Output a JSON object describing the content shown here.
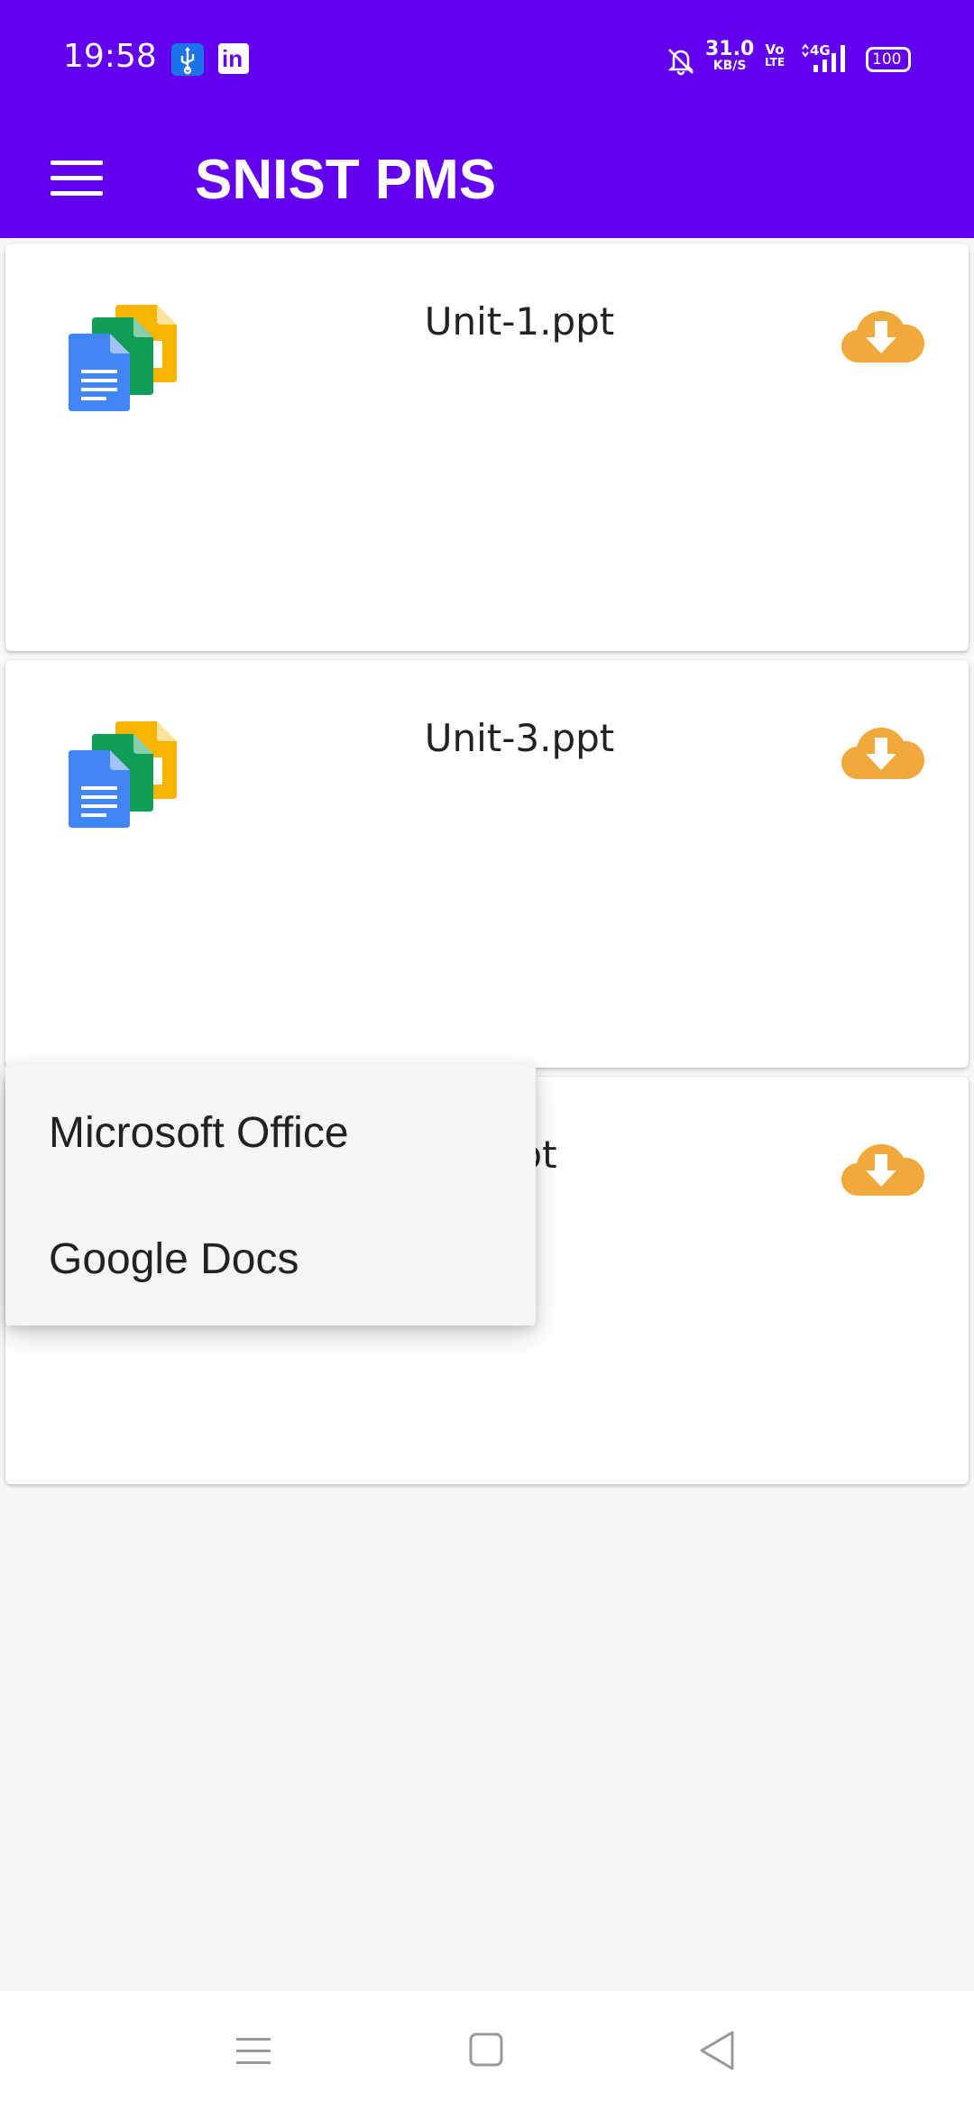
{
  "status_bar": {
    "time": "19:58",
    "icons": [
      "usb-debug-icon",
      "linkedin-icon",
      "bell-off-icon",
      "volte-icon",
      "signal-icon",
      "battery-icon"
    ],
    "net_speed_value": "31.0",
    "net_speed_unit": "KB/S",
    "volte_top": "Vo",
    "volte_bottom": "LTE",
    "network_type": "4G",
    "battery_level": "100"
  },
  "app_bar": {
    "title": "SNIST PMS",
    "menu_icon": "hamburger-icon",
    "color": "#6200ee"
  },
  "files": [
    {
      "name": "Unit-1.ppt",
      "icon": "documents-icon",
      "action_icon": "cloud-download-icon"
    },
    {
      "name": "Unit-3.ppt",
      "icon": "documents-icon",
      "action_icon": "cloud-download-icon"
    },
    {
      "name": ".ppt",
      "icon": "documents-icon",
      "action_icon": "cloud-download-icon"
    }
  ],
  "popup_menu": {
    "items": [
      {
        "label": "Microsoft Office"
      },
      {
        "label": "Google Docs"
      }
    ]
  },
  "nav_bar": {
    "buttons": [
      "recents-icon",
      "home-icon",
      "back-icon"
    ]
  },
  "colors": {
    "primary": "#6200ee",
    "download_accent": "#f2a93b",
    "background": "#f7f7f7"
  }
}
